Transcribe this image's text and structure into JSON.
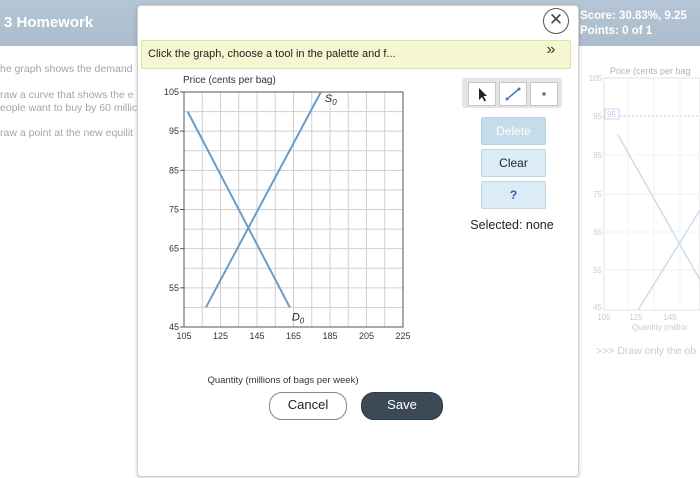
{
  "header": {
    "title": "3 Homework"
  },
  "score": {
    "score_text": "Score: 30.83%, 9.25",
    "points_text": "Points: 0 of 1"
  },
  "background": {
    "lines": [
      "he graph shows the demand",
      "raw a curve that shows the e",
      "eople want to buy by 60 millic",
      "raw a point at the new equilit"
    ],
    "right_chart": {
      "y_title": "Price (cents per bag",
      "y_ticks": [
        "105",
        "95",
        "85",
        "75",
        "65",
        "55",
        "45"
      ],
      "x_ticks": [
        "105",
        "125",
        "145"
      ],
      "x_title": "Quantity (millior",
      "value_label": "95"
    },
    "hint": ">>> Draw only the ob"
  },
  "dialog": {
    "instruction": "Click the graph, choose a tool in the palette and f...",
    "close_icon": "close-icon",
    "expand_icon": "double-chevron-down-icon",
    "buttons": {
      "delete": "Delete",
      "clear": "Clear",
      "help": "?",
      "cancel": "Cancel",
      "save": "Save"
    },
    "selected_text": "Selected: none",
    "palette": [
      "pointer-tool-icon",
      "line-tool-icon",
      "point-tool-icon"
    ]
  },
  "chart_data": {
    "type": "line",
    "ylabel": "Price (cents per bag)",
    "xlabel": "Quantity (millions of bags per week)",
    "xlim": [
      105,
      225
    ],
    "ylim": [
      45,
      105
    ],
    "x_ticks": [
      "105",
      "125",
      "145",
      "165",
      "185",
      "205",
      "225"
    ],
    "y_ticks": [
      "105",
      "95",
      "85",
      "75",
      "65",
      "55",
      "45"
    ],
    "grid": true,
    "series": [
      {
        "name": "S0",
        "label_main": "S",
        "label_sub": "0",
        "color": "#6a9cc7",
        "points": [
          [
            117,
            50
          ],
          [
            180,
            105
          ]
        ]
      },
      {
        "name": "D0",
        "label_main": "D",
        "label_sub": "0",
        "color": "#6a9cc7",
        "points": [
          [
            107,
            100
          ],
          [
            163,
            50
          ]
        ]
      }
    ]
  }
}
